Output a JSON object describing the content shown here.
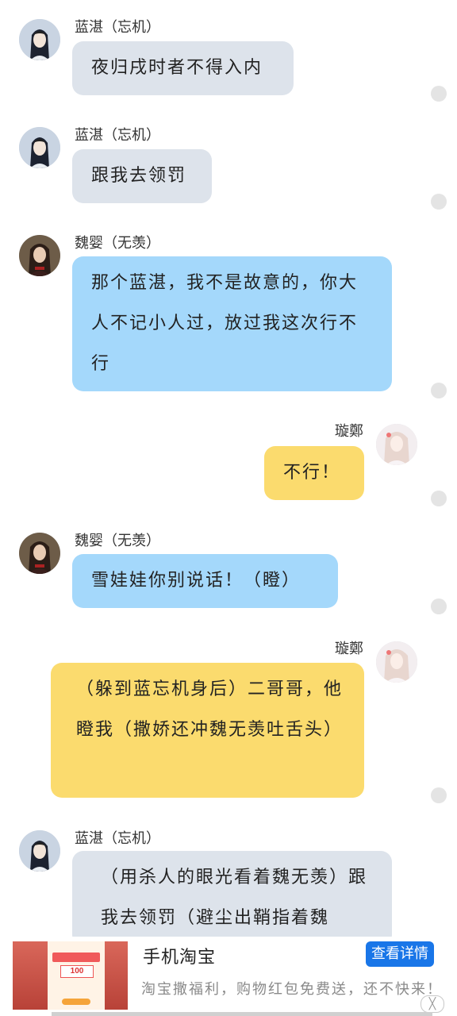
{
  "messages": [
    {
      "sender": "蓝湛（忘机）",
      "text": "夜归戌时者不得入内"
    },
    {
      "sender": "蓝湛（忘机）",
      "text": "跟我去领罚"
    },
    {
      "sender": "魏婴（无羡）",
      "text": "那个蓝湛，我不是故意的，你大人不记小人过，放过我这次行不行"
    },
    {
      "sender": "璇鄭",
      "text": "不行！"
    },
    {
      "sender": "魏婴（无羡）",
      "text": "雪娃娃你别说话！（瞪）"
    },
    {
      "sender": "璇鄭",
      "text": "（躲到蓝忘机身后）二哥哥，他瞪我（撒娇还冲魏无羡吐舌头）"
    },
    {
      "sender": "蓝湛（忘机）",
      "text": "（用杀人的眼光看着魏无羡）跟我去领罚（避尘出鞘指着魏"
    }
  ],
  "ad": {
    "title": "手机淘宝",
    "description": "淘宝撒福利，购物红包免费送，还不快来！",
    "button": "查看详情",
    "close": "╳",
    "image_text": "100"
  },
  "colors": {
    "bubble_gray": "#dde3eb",
    "bubble_blue": "#a4d8fb",
    "bubble_yellow": "#fbdb6e",
    "ad_button": "#1976e8"
  }
}
